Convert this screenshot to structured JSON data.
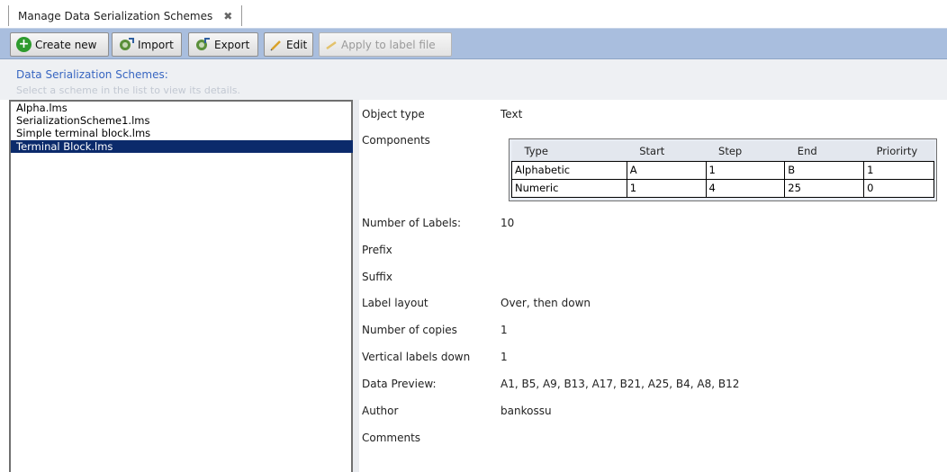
{
  "tab": {
    "label": "Manage Data Serialization Schemes",
    "close": "✖"
  },
  "toolbar": {
    "create_new": "Create new",
    "import": "Import",
    "export": "Export",
    "edit": "Edit",
    "apply": "Apply to label file"
  },
  "header": {
    "title": "Data Serialization Schemes:",
    "subtitle": "Select a scheme in the list to view its details."
  },
  "schemes": [
    "Alpha.lms",
    "SerializationScheme1.lms",
    "Simple terminal block.lms",
    "Terminal Block.lms"
  ],
  "selected_scheme": "Terminal Block.lms",
  "details": {
    "object_type_label": "Object type",
    "object_type": "Text",
    "components_label": "Components",
    "components": {
      "headers": [
        "Type",
        "Start",
        "Step",
        "End",
        "Priorirty"
      ],
      "rows": [
        [
          "Alphabetic",
          "A",
          "1",
          "B",
          "1"
        ],
        [
          "Numeric",
          "1",
          "4",
          "25",
          "0"
        ]
      ]
    },
    "num_labels_label": "Number of Labels:",
    "num_labels": "10",
    "prefix_label": "Prefix",
    "suffix_label": "Suffix",
    "layout_label": "Label layout",
    "layout": "Over, then down",
    "copies_label": "Number of copies",
    "copies": "1",
    "vertical_label": "Vertical labels down",
    "vertical": "1",
    "preview_label": "Data Preview:",
    "preview": "A1, B5, A9, B13, A17, B21, A25, B4, A8, B12",
    "author_label": "Author",
    "author": "bankossu",
    "comments_label": "Comments"
  },
  "colors": {
    "toolbar_bg": "#a9bede",
    "selection": "#0b2a6b",
    "title": "#3866c1"
  }
}
